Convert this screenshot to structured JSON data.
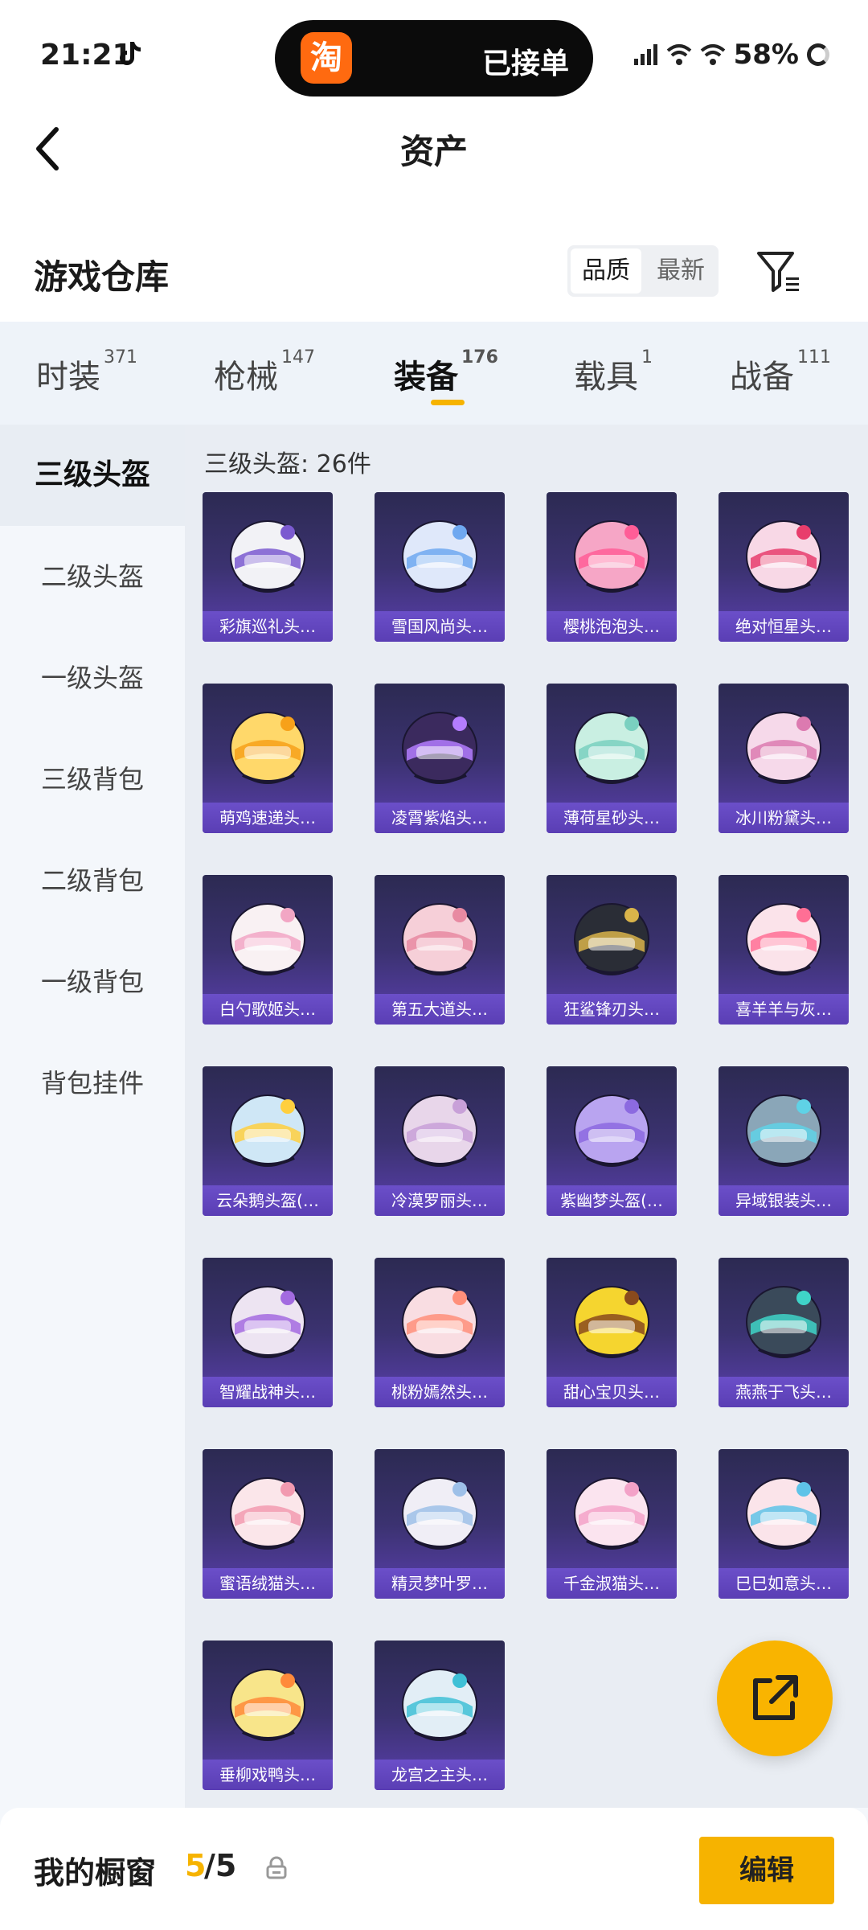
{
  "status_bar": {
    "time": "21:21",
    "pill_logo": "淘",
    "pill_text": "已接单",
    "network": "5G",
    "battery": "58%"
  },
  "header": {
    "title": "资产"
  },
  "warehouse": {
    "title": "游戏仓库",
    "sort_options": [
      "品质",
      "最新"
    ]
  },
  "tabs": [
    {
      "label": "时装",
      "count": "371"
    },
    {
      "label": "枪械",
      "count": "147"
    },
    {
      "label": "装备",
      "count": "176",
      "active": true
    },
    {
      "label": "载具",
      "count": "1"
    },
    {
      "label": "战备",
      "count": "111"
    }
  ],
  "sidebar": {
    "items": [
      "三级头盔",
      "二级头盔",
      "一级头盔",
      "三级背包",
      "二级背包",
      "一级背包",
      "背包挂件"
    ],
    "active_index": 0
  },
  "grid": {
    "count_label": "三级头盔: 26件",
    "items": [
      {
        "name": "彩旗巡礼头…",
        "color": "#f2f2f6",
        "accent": "#7b5ad0"
      },
      {
        "name": "雪国风尚头…",
        "color": "#dfe8fa",
        "accent": "#6fa8f0"
      },
      {
        "name": "樱桃泡泡头…",
        "color": "#f6a6c6",
        "accent": "#ff5d97"
      },
      {
        "name": "绝对恒星头…",
        "color": "#f8d8e6",
        "accent": "#e83d6c"
      },
      {
        "name": "萌鸡速递头…",
        "color": "#ffd86a",
        "accent": "#f7a11a"
      },
      {
        "name": "凌霄紫焰头…",
        "color": "#3b2a5e",
        "accent": "#b47dff"
      },
      {
        "name": "薄荷星砂头…",
        "color": "#c9efe2",
        "accent": "#7ad0c0"
      },
      {
        "name": "冰川粉黛头…",
        "color": "#f6d9ea",
        "accent": "#dc7ab0"
      },
      {
        "name": "白勺歌姬头…",
        "color": "#f9f1f3",
        "accent": "#f2a6c4"
      },
      {
        "name": "第五大道头…",
        "color": "#f6cfd8",
        "accent": "#e88aa2"
      },
      {
        "name": "狂鲨锋刃头…",
        "color": "#2a2d36",
        "accent": "#d9b44a"
      },
      {
        "name": "喜羊羊与灰…",
        "color": "#fbe3ea",
        "accent": "#ff6f95"
      },
      {
        "name": "云朵鹅头盔(…",
        "color": "#cfe7f6",
        "accent": "#ffcf3f"
      },
      {
        "name": "冷漠罗丽头…",
        "color": "#e8d6ea",
        "accent": "#c8a0d8"
      },
      {
        "name": "紫幽梦头盔(…",
        "color": "#b9a4f0",
        "accent": "#8c6ae0"
      },
      {
        "name": "异域银装头…",
        "color": "#8aa6b8",
        "accent": "#5fd2e6"
      },
      {
        "name": "智耀战神头…",
        "color": "#ede4f2",
        "accent": "#a36be0"
      },
      {
        "name": "桃粉嫣然头…",
        "color": "#f9dde2",
        "accent": "#ff8f7a"
      },
      {
        "name": "甜心宝贝头…",
        "color": "#f5d52f",
        "accent": "#8a4a1d"
      },
      {
        "name": "燕燕于飞头…",
        "color": "#3a4a5a",
        "accent": "#3fd4c8"
      },
      {
        "name": "蜜语绒猫头…",
        "color": "#fbe6ea",
        "accent": "#f29ab0"
      },
      {
        "name": "精灵梦叶罗…",
        "color": "#f0eef6",
        "accent": "#9ec0e8"
      },
      {
        "name": "千金淑猫头…",
        "color": "#fbe4ef",
        "accent": "#f3a2c8"
      },
      {
        "name": "巳巳如意头…",
        "color": "#fbe4ea",
        "accent": "#5ec3e8"
      },
      {
        "name": "垂柳戏鸭头…",
        "color": "#f8e58a",
        "accent": "#ff8a3a"
      },
      {
        "name": "龙宫之主头…",
        "color": "#e2eef6",
        "accent": "#3fc0d6"
      }
    ]
  },
  "bottom": {
    "label": "我的橱窗",
    "current": "5",
    "total": "/5",
    "edit_label": "编辑"
  },
  "icons": [
    "tiktok-icon",
    "signal-icon",
    "wifi-icon",
    "battery-ring-icon",
    "back-arrow-icon",
    "filter-icon",
    "share-external-icon",
    "lock-icon"
  ]
}
